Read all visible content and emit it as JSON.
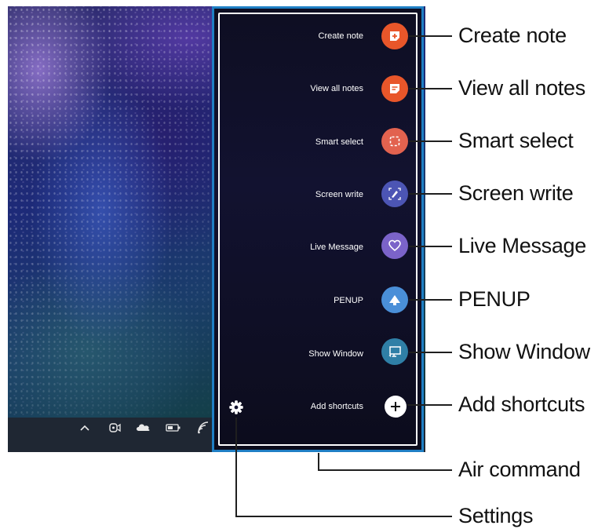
{
  "air_command": {
    "items": [
      {
        "label": "Create note",
        "icon": "create-note-icon",
        "color": "#e8562a"
      },
      {
        "label": "View all notes",
        "icon": "view-notes-icon",
        "color": "#e8562a"
      },
      {
        "label": "Smart select",
        "icon": "smart-select-icon",
        "color": "#e2624f"
      },
      {
        "label": "Screen write",
        "icon": "screen-write-icon",
        "color": "#4c55b4"
      },
      {
        "label": "Live Message",
        "icon": "live-message-icon",
        "color": "#7b63c9"
      },
      {
        "label": "PENUP",
        "icon": "penup-icon",
        "color": "#4a8fd8"
      },
      {
        "label": "Show Window",
        "icon": "show-window-icon",
        "color": "#2f7fa6"
      },
      {
        "label": "Add shortcuts",
        "icon": "plus-icon",
        "color": "#ffffff"
      }
    ],
    "settings_icon": "gear-icon"
  },
  "callouts": {
    "create_note": "Create note",
    "view_all_notes": "View all notes",
    "smart_select": "Smart select",
    "screen_write": "Screen write",
    "live_message": "Live Message",
    "penup": "PENUP",
    "show_window": "Show Window",
    "add_shortcuts": "Add shortcuts",
    "air_command": "Air command",
    "settings": "Settings"
  },
  "taskbar": {
    "icons": [
      "chevron-up-icon",
      "camera-icon",
      "cloud-icon",
      "battery-icon",
      "wifi-icon"
    ]
  },
  "colors": {
    "highlight_border": "#1f7fc4",
    "panel_bg": "#121230"
  }
}
